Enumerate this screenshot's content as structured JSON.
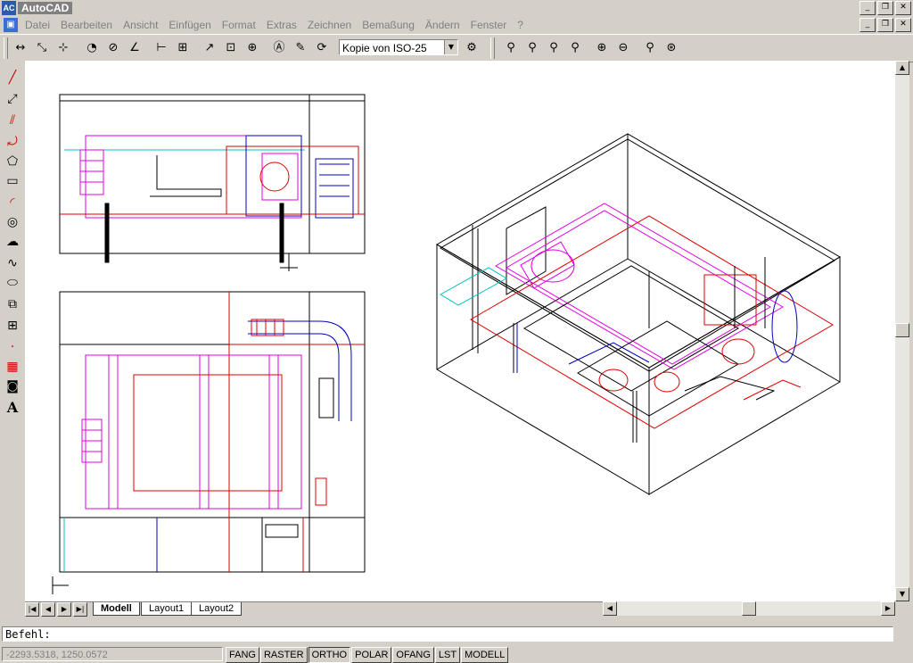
{
  "window": {
    "title": "AutoCAD"
  },
  "menu": [
    "Datei",
    "Bearbeiten",
    "Ansicht",
    "Einfügen",
    "Format",
    "Extras",
    "Zeichnen",
    "Bemaßung",
    "Ändern",
    "Fenster",
    "?"
  ],
  "toolbar": {
    "dimstyle": "Kopie von ISO-25"
  },
  "tabs": [
    "Modell",
    "Layout1",
    "Layout2"
  ],
  "command": {
    "prompt": "Befehl:"
  },
  "status": {
    "coords": "-2293.5318, 1250.0572",
    "buttons": [
      "FANG",
      "RASTER",
      "ORTHO",
      "POLAR",
      "OFANG",
      "LST",
      "MODELL"
    ]
  },
  "colors": {
    "magenta": "#e000e0",
    "red": "#e00000",
    "blue": "#0000c0",
    "cyan": "#00c0c0",
    "black": "#000000"
  }
}
